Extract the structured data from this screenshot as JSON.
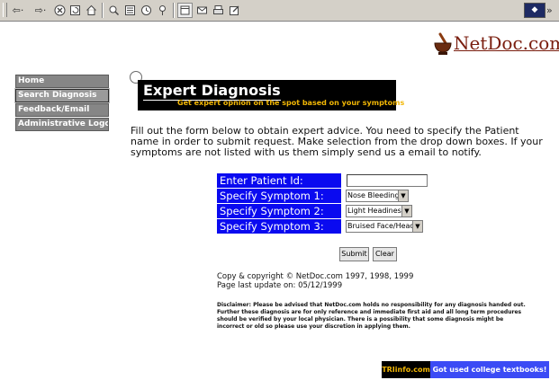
{
  "toolbar": {
    "back_label": "⇦·",
    "forward_label": "⇨·",
    "overflow_label": "»"
  },
  "brand": {
    "name": "NetDoc.com"
  },
  "nav": {
    "items": [
      {
        "label": "Home"
      },
      {
        "label": "Search Diagnosis"
      },
      {
        "label": "Feedback/Email"
      },
      {
        "label": "Administrative Logon"
      }
    ]
  },
  "banner": {
    "title": "Expert Diagnosis",
    "subtitle": "Get expert opnion on the spot based on your symptoms"
  },
  "intro": "Fill out the form below to obtain expert advice.  You need to specify the Patient name in order to submit request.  Make selection from the drop down boxes.  If your symptoms are not listed with us them simply send us a email to notify.",
  "form": {
    "patient_label": "Enter Patient Id:",
    "patient_value": "",
    "symptom1_label": "Specify Symptom 1:",
    "symptom1_value": "Nose Bleeding",
    "symptom2_label": "Specify Symptom 2:",
    "symptom2_value": "Light Headiness",
    "symptom3_label": "Specify Symptom 3:",
    "symptom3_value": "Bruised Face/Head",
    "submit_label": "Submit",
    "clear_label": "Clear"
  },
  "footer": {
    "copyright": "Copy & copyright © NetDoc.com 1997, 1998, 1999",
    "last_update": "Page last update on: 05/12/1999",
    "disclaimer": "Disclaimer: Please be advised that NetDoc.com holds no responsibility for any diagnosis handed out.  Further these diagnosis are for only reference and immediate first aid and all long term procedures should be verified by your local physician.  There is  a possibility that some diagnosis might be incorrect or old so please use your discretion in applying them."
  },
  "ad": {
    "site": "TRIinfo.com",
    "tagline": "Got used college textbooks!"
  },
  "colors": {
    "form_label_bg": "#0a0af0",
    "nav_bg": "#868686",
    "banner_bg": "#000000",
    "banner_subtitle": "#f2b705",
    "ad_right_bg": "#3b4bf5",
    "brand_text": "#7a1e0f"
  }
}
